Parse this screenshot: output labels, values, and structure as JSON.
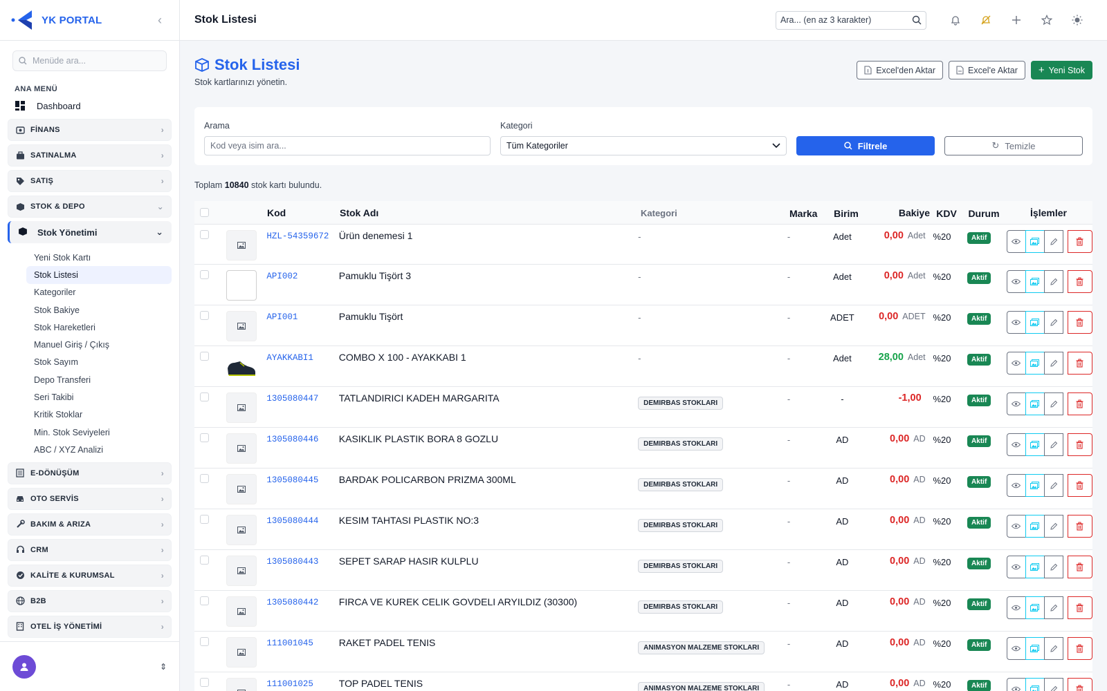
{
  "brand": {
    "name": "YK PORTAL"
  },
  "sidebar": {
    "search_placeholder": "Menüde ara...",
    "section_label": "ANA MENÜ",
    "dashboard_label": "Dashboard",
    "groups_top": [
      {
        "label": "FİNANS",
        "icon": "finance-icon"
      },
      {
        "label": "SATINALMA",
        "icon": "briefcase-icon"
      },
      {
        "label": "SATIŞ",
        "icon": "tag-icon"
      },
      {
        "label": "STOK & DEPO",
        "icon": "box-icon"
      }
    ],
    "stock_mgmt_label": "Stok Yönetimi",
    "sub_items": [
      "Yeni Stok Kartı",
      "Stok Listesi",
      "Kategoriler",
      "Stok Bakiye",
      "Stok Hareketleri",
      "Manuel Giriş / Çıkış",
      "Stok Sayım",
      "Depo Transferi",
      "Seri Takibi",
      "Kritik Stoklar",
      "Min. Stok Seviyeleri",
      "ABC / XYZ Analizi"
    ],
    "groups_bottom": [
      {
        "label": "E-DÖNÜŞÜM",
        "icon": "document-icon"
      },
      {
        "label": "OTO SERVİS",
        "icon": "car-icon"
      },
      {
        "label": "BAKIM & ARIZA",
        "icon": "wrench-icon"
      },
      {
        "label": "CRM",
        "icon": "headset-icon"
      },
      {
        "label": "KALİTE & KURUMSAL",
        "icon": "quality-icon"
      },
      {
        "label": "B2B",
        "icon": "globe-icon"
      },
      {
        "label": "OTEL İŞ YÖNETİMİ",
        "icon": "building-icon"
      }
    ]
  },
  "topbar": {
    "title": "Stok Listesi",
    "search_placeholder": "Ara... (en az 3 karakter)"
  },
  "page": {
    "title": "Stok Listesi",
    "subtitle": "Stok kartlarınızı yönetin.",
    "btn_import": "Excel'den Aktar",
    "btn_export": "Excel'e Aktar",
    "btn_new": "Yeni Stok"
  },
  "filters": {
    "search_label": "Arama",
    "search_placeholder": "Kod veya isim ara...",
    "category_label": "Kategori",
    "category_value": "Tüm Kategoriler",
    "btn_filter": "Filtrele",
    "btn_clear": "Temizle"
  },
  "summary": {
    "prefix": "Toplam",
    "count": "10840",
    "suffix": "stok kartı bulundu."
  },
  "table": {
    "headers": {
      "kod": "Kod",
      "name": "Stok Adı",
      "kategori": "Kategori",
      "marka": "Marka",
      "birim": "Birim",
      "bakiye": "Bakiye",
      "kdv": "KDV",
      "durum": "Durum",
      "islemler": "İşlemler"
    },
    "rows": [
      {
        "kod": "HZL-54359672",
        "name": "Ürün denemesi 1",
        "kategori": "-",
        "marka": "-",
        "birim": "Adet",
        "bakiye": "0,00",
        "bakiye_unit": "Adet",
        "kdv": "%20",
        "durum": "Aktif",
        "img": "placeholder"
      },
      {
        "kod": "API002",
        "name": "Pamuklu Tişört 3",
        "kategori": "-",
        "marka": "-",
        "birim": "Adet",
        "bakiye": "0,00",
        "bakiye_unit": "Adet",
        "kdv": "%20",
        "durum": "Aktif",
        "img": "broken"
      },
      {
        "kod": "API001",
        "name": "Pamuklu Tişört",
        "kategori": "-",
        "marka": "-",
        "birim": "ADET",
        "bakiye": "0,00",
        "bakiye_unit": "ADET",
        "kdv": "%20",
        "durum": "Aktif",
        "img": "placeholder"
      },
      {
        "kod": "AYAKKABI1",
        "name": "COMBO X 100 - AYAKKABI 1",
        "kategori": "-",
        "marka": "-",
        "birim": "Adet",
        "bakiye": "28,00",
        "bakiye_unit": "Adet",
        "kdv": "%20",
        "durum": "Aktif",
        "img": "shoe"
      },
      {
        "kod": "1305080447",
        "name": "TATLANDIRICI KADEH MARGARITA",
        "kategori": "DEMIRBAS STOKLARI",
        "marka": "-",
        "birim": "-",
        "bakiye": "-1,00",
        "bakiye_unit": "",
        "kdv": "%20",
        "durum": "Aktif",
        "img": "placeholder"
      },
      {
        "kod": "1305080446",
        "name": "KASIKLIK PLASTIK BORA 8 GOZLU",
        "kategori": "DEMIRBAS STOKLARI",
        "marka": "-",
        "birim": "AD",
        "bakiye": "0,00",
        "bakiye_unit": "AD",
        "kdv": "%20",
        "durum": "Aktif",
        "img": "placeholder"
      },
      {
        "kod": "1305080445",
        "name": "BARDAK POLICARBON PRIZMA 300ML",
        "kategori": "DEMIRBAS STOKLARI",
        "marka": "-",
        "birim": "AD",
        "bakiye": "0,00",
        "bakiye_unit": "AD",
        "kdv": "%20",
        "durum": "Aktif",
        "img": "placeholder"
      },
      {
        "kod": "1305080444",
        "name": "KESIM TAHTASI PLASTIK NO:3",
        "kategori": "DEMIRBAS STOKLARI",
        "marka": "-",
        "birim": "AD",
        "bakiye": "0,00",
        "bakiye_unit": "AD",
        "kdv": "%20",
        "durum": "Aktif",
        "img": "placeholder"
      },
      {
        "kod": "1305080443",
        "name": "SEPET SARAP HASIR KULPLU",
        "kategori": "DEMIRBAS STOKLARI",
        "marka": "-",
        "birim": "AD",
        "bakiye": "0,00",
        "bakiye_unit": "AD",
        "kdv": "%20",
        "durum": "Aktif",
        "img": "placeholder"
      },
      {
        "kod": "1305080442",
        "name": "FIRCA VE KUREK CELIK GOVDELI ARYILDIZ (30300)",
        "kategori": "DEMIRBAS STOKLARI",
        "marka": "-",
        "birim": "AD",
        "bakiye": "0,00",
        "bakiye_unit": "AD",
        "kdv": "%20",
        "durum": "Aktif",
        "img": "placeholder"
      },
      {
        "kod": "111001045",
        "name": "RAKET PADEL TENIS",
        "kategori": "ANIMASYON MALZEME STOKLARI",
        "marka": "-",
        "birim": "AD",
        "bakiye": "0,00",
        "bakiye_unit": "AD",
        "kdv": "%20",
        "durum": "Aktif",
        "img": "placeholder"
      },
      {
        "kod": "111001025",
        "name": "TOP PADEL TENIS",
        "kategori": "ANIMASYON MALZEME STOKLARI",
        "marka": "-",
        "birim": "AD",
        "bakiye": "0,00",
        "bakiye_unit": "AD",
        "kdv": "%20",
        "durum": "Aktif",
        "img": "placeholder"
      }
    ]
  },
  "colors": {
    "accent": "#2563eb",
    "success": "#198754",
    "danger": "#dc2626",
    "info": "#0dcaf0"
  }
}
